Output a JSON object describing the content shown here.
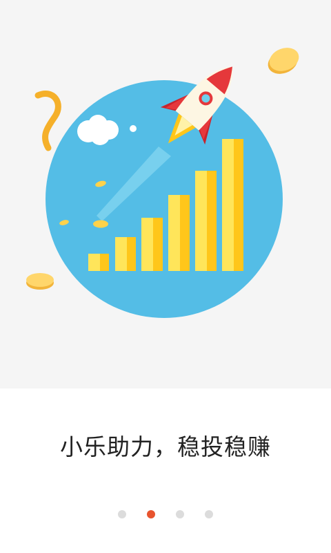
{
  "onboarding": {
    "slogan": "小乐助力，稳投稳赚",
    "illustration": "rocket-growth-chart-illustration",
    "pager": {
      "total": 4,
      "active_index": 1
    }
  },
  "colors": {
    "hero_background": "#f5f5f5",
    "circle": "#54bde6",
    "bar_light": "#ffe55a",
    "bar_dark": "#ffc61a",
    "rocket_red": "#e5383b",
    "dot_active": "#e8542e",
    "dot_inactive": "#dcdcdc"
  }
}
